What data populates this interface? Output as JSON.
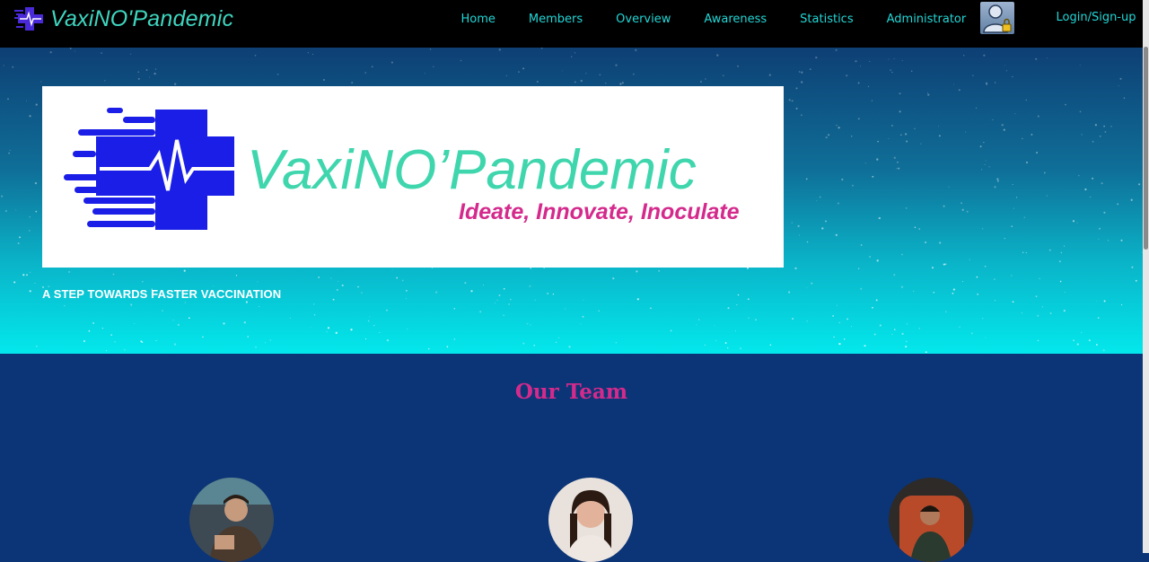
{
  "navbar": {
    "brand": "VaxiNO'Pandemic",
    "links": [
      "Home",
      "Members",
      "Overview",
      "Awareness",
      "Statistics",
      "Administrator"
    ],
    "login": "Login/Sign-up",
    "icons": {
      "brand": "medical-cross-logo-icon",
      "admin": "user-lock-icon"
    }
  },
  "hero": {
    "banner_title": "VaxiNO’Pandemic",
    "banner_subtitle": "Ideate, Innovate, Inoculate",
    "tagline": "A STEP TOWARDS FASTER VACCINATION"
  },
  "team": {
    "title": "Our Team",
    "members": [
      "member-1",
      "member-2",
      "member-3"
    ]
  },
  "colors": {
    "nav_bg": "#000000",
    "nav_link": "#22d6d6",
    "brand_teal": "#3fd6c0",
    "brand_blue": "#1a1ee6",
    "accent_pink": "#d42a8c",
    "page_bg": "#0b3577"
  }
}
